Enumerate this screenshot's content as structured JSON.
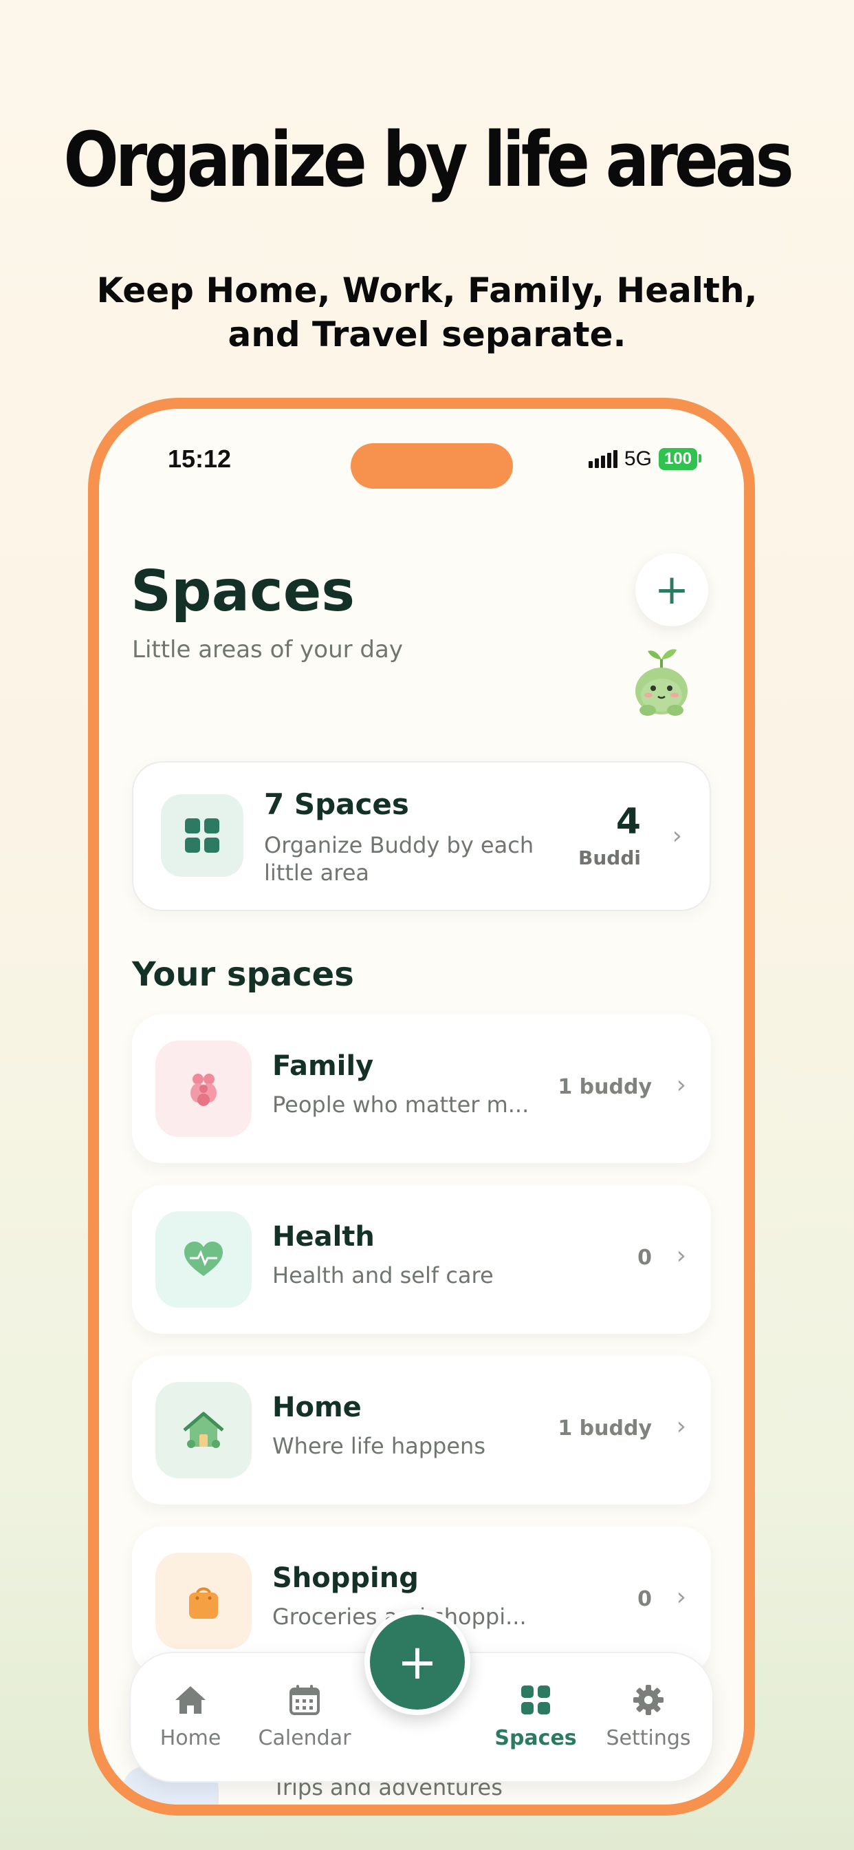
{
  "promo": {
    "headline": "Organize by life areas",
    "subheadline": "Keep Home, Work, Family, Health, and Travel separate."
  },
  "status_bar": {
    "time": "15:12",
    "network": "5G",
    "battery": "100"
  },
  "header": {
    "title": "Spaces",
    "subtitle": "Little areas of your day",
    "add_icon": "plus-icon"
  },
  "summary": {
    "title": "7 Spaces",
    "description": "Organize Buddy by each little area",
    "count": "4",
    "count_label": "Buddi"
  },
  "section": {
    "title": "Your spaces"
  },
  "spaces": [
    {
      "name": "Family",
      "description": "People who matter m...",
      "count": "1 buddy",
      "icon": "family-icon",
      "icon_bg": "#fdecee"
    },
    {
      "name": "Health",
      "description": "Health and self care",
      "count": "0",
      "icon": "heart-icon",
      "icon_bg": "#e6f6f1"
    },
    {
      "name": "Home",
      "description": "Where life happens",
      "count": "1 buddy",
      "icon": "house-icon",
      "icon_bg": "#e7f3eb"
    },
    {
      "name": "Shopping",
      "description": "Groceries and shoppi...",
      "count": "0",
      "icon": "shopping-bag-icon",
      "icon_bg": "#fdf0e1"
    },
    {
      "description": "Trips and adventures",
      "icon": "travel-icon"
    }
  ],
  "tabbar": {
    "home": "Home",
    "calendar": "Calendar",
    "spaces": "Spaces",
    "settings": "Settings",
    "active": "Spaces"
  },
  "colors": {
    "accent": "#2c7a61",
    "frame": "#f7924e"
  }
}
